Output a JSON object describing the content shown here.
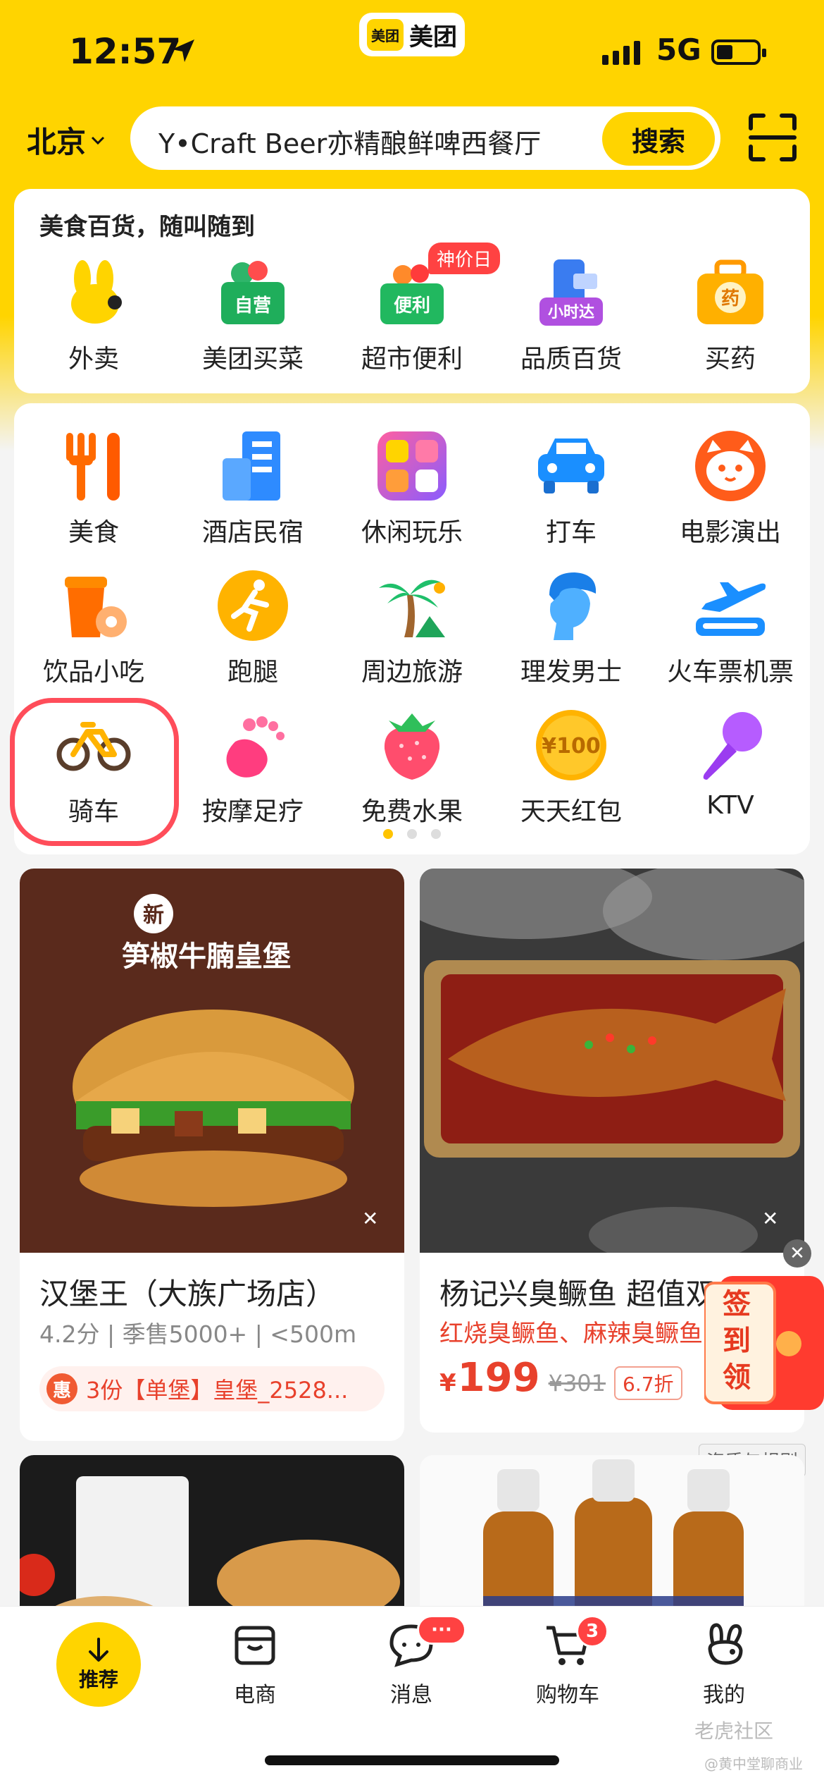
{
  "colors": {
    "brand_yellow": "#ffd400",
    "accent_red": "#e8412c",
    "mark_red": "#ff4d5a"
  },
  "status_bar": {
    "time": "12:57",
    "network": "5G",
    "app_badge_logo": "美团",
    "app_badge_name": "美团"
  },
  "header": {
    "city": "北京",
    "search_value": "Y•Craft Beer亦精酿鲜啤西餐厅",
    "search_button": "搜索",
    "scan_icon": "scan-icon"
  },
  "quick_card": {
    "title": "美食百货，随叫随到",
    "promo_tag": "神价日",
    "items": [
      {
        "label": "外卖",
        "icon": "rabbit-icon"
      },
      {
        "label": "美团买菜",
        "icon": "grocery-basket-icon",
        "badge": "自营"
      },
      {
        "label": "超市便利",
        "icon": "market-basket-icon",
        "badge": "便利"
      },
      {
        "label": "品质百货",
        "icon": "phone-bag-icon",
        "badge": "小时达"
      },
      {
        "label": "买药",
        "icon": "medicine-box-icon",
        "badge": "药"
      }
    ]
  },
  "services": {
    "rows": [
      [
        {
          "label": "美食",
          "icon": "fork-knife-icon"
        },
        {
          "label": "酒店民宿",
          "icon": "hotel-building-icon"
        },
        {
          "label": "休闲玩乐",
          "icon": "leisure-grid-icon"
        },
        {
          "label": "打车",
          "icon": "car-icon"
        },
        {
          "label": "电影演出",
          "icon": "cat-face-icon"
        }
      ],
      [
        {
          "label": "饮品小吃",
          "icon": "drink-cup-icon"
        },
        {
          "label": "跑腿",
          "icon": "runner-icon"
        },
        {
          "label": "周边旅游",
          "icon": "palm-tree-icon"
        },
        {
          "label": "理发男士",
          "icon": "man-head-icon"
        },
        {
          "label": "火车票机票",
          "icon": "plane-icon"
        }
      ],
      [
        {
          "label": "骑车",
          "icon": "bicycle-icon"
        },
        {
          "label": "按摩足疗",
          "icon": "footprint-icon"
        },
        {
          "label": "免费水果",
          "icon": "strawberry-icon"
        },
        {
          "label": "天天红包",
          "icon": "coin-icon",
          "coin_text": "¥100"
        },
        {
          "label": "KTV",
          "icon": "microphone-icon"
        }
      ]
    ],
    "page_count": 3,
    "active_page": 1
  },
  "feed": {
    "card_left": {
      "image_new_badge": "新",
      "image_title": "笋椒牛腩皇堡",
      "shop_name": "汉堡王（大族广场店）",
      "meta": "4.2分 | 季售5000+ | <500m",
      "coupon_badge": "惠",
      "coupon_text": "3份【单堡】皇堡_2528..."
    },
    "card_right": {
      "shop_name": "杨记兴臭鳜鱼 超值双人餐",
      "dishes": "红烧臭鳜鱼、麻辣臭鳜鱼",
      "currency": "¥",
      "price": "199",
      "old_price": "¥301",
      "discount": "6.7折"
    },
    "checkin_text": "签到领",
    "rules_text": "资质与规则"
  },
  "tabbar": {
    "items": [
      {
        "label": "推荐",
        "icon": "arrow-down-icon"
      },
      {
        "label": "电商",
        "icon": "shopping-box-icon"
      },
      {
        "label": "消息",
        "icon": "chat-bubble-icon",
        "badge": "···"
      },
      {
        "label": "购物车",
        "icon": "cart-icon",
        "badge": "3"
      },
      {
        "label": "我的",
        "icon": "rabbit-outline-icon"
      }
    ]
  },
  "watermark": {
    "line1": "老虎社区",
    "line2": "@黄中堂聊商业"
  }
}
